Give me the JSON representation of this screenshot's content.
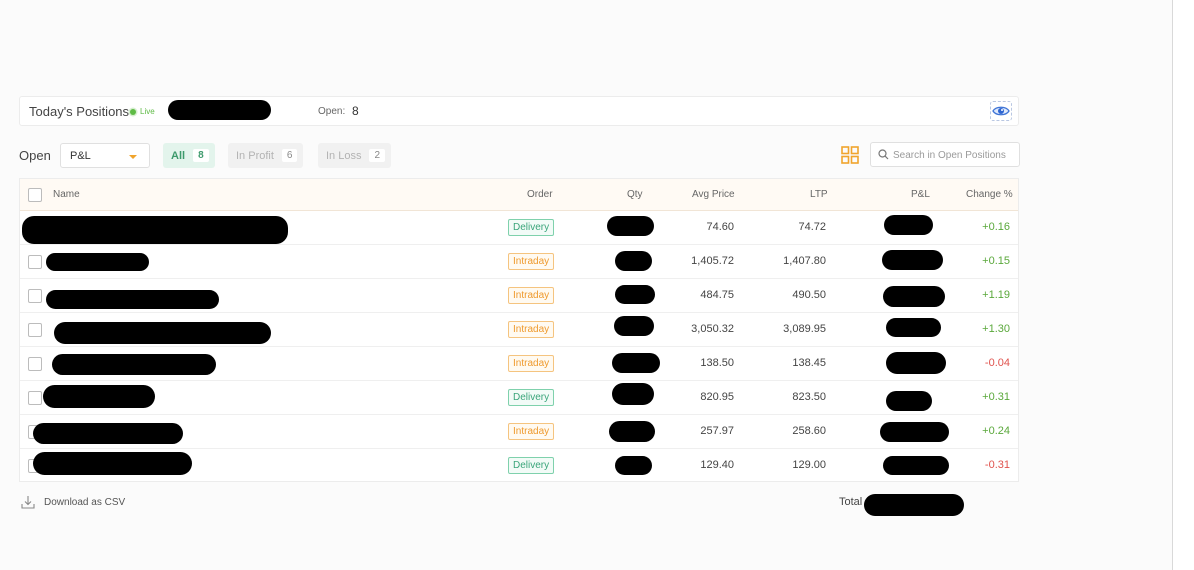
{
  "header": {
    "title": "Today's Positions",
    "live": "Live",
    "open_label": "Open:",
    "open_count": "8"
  },
  "filters": {
    "open_word": "Open",
    "sort_selected": "P&L",
    "chips": [
      {
        "label": "All",
        "count": "8"
      },
      {
        "label": "In Profit",
        "count": "6"
      },
      {
        "label": "In Loss",
        "count": "2"
      }
    ],
    "search_placeholder": "Search in Open Positions"
  },
  "table": {
    "columns": [
      "Name",
      "Order",
      "Qty",
      "Avg Price",
      "LTP",
      "P&L",
      "Change %"
    ],
    "rows": [
      {
        "order": "Delivery",
        "avg": "74.60",
        "ltp": "74.72",
        "change": "+0.16",
        "trend": "pos"
      },
      {
        "order": "Intraday",
        "avg": "1,405.72",
        "ltp": "1,407.80",
        "change": "+0.15",
        "trend": "pos"
      },
      {
        "order": "Intraday",
        "avg": "484.75",
        "ltp": "490.50",
        "change": "+1.19",
        "trend": "pos"
      },
      {
        "order": "Intraday",
        "avg": "3,050.32",
        "ltp": "3,089.95",
        "change": "+1.30",
        "trend": "pos"
      },
      {
        "order": "Intraday",
        "avg": "138.50",
        "ltp": "138.45",
        "change": "-0.04",
        "trend": "neg"
      },
      {
        "order": "Delivery",
        "avg": "820.95",
        "ltp": "823.50",
        "change": "+0.31",
        "trend": "pos"
      },
      {
        "order": "Intraday",
        "avg": "257.97",
        "ltp": "258.60",
        "change": "+0.24",
        "trend": "pos"
      },
      {
        "order": "Delivery",
        "avg": "129.40",
        "ltp": "129.00",
        "change": "-0.31",
        "trend": "neg"
      }
    ]
  },
  "footer": {
    "download_label": "Download as CSV",
    "total_label": "Total"
  },
  "colors": {
    "profit": "#5aa83b",
    "loss": "#e0534e",
    "delivery": "#3aa57a",
    "intraday": "#ef9a2d",
    "accent": "#f0a42c"
  },
  "icons": [
    "eye-icon",
    "chevron-down-icon",
    "grid-view-icon",
    "search-icon",
    "download-icon"
  ]
}
